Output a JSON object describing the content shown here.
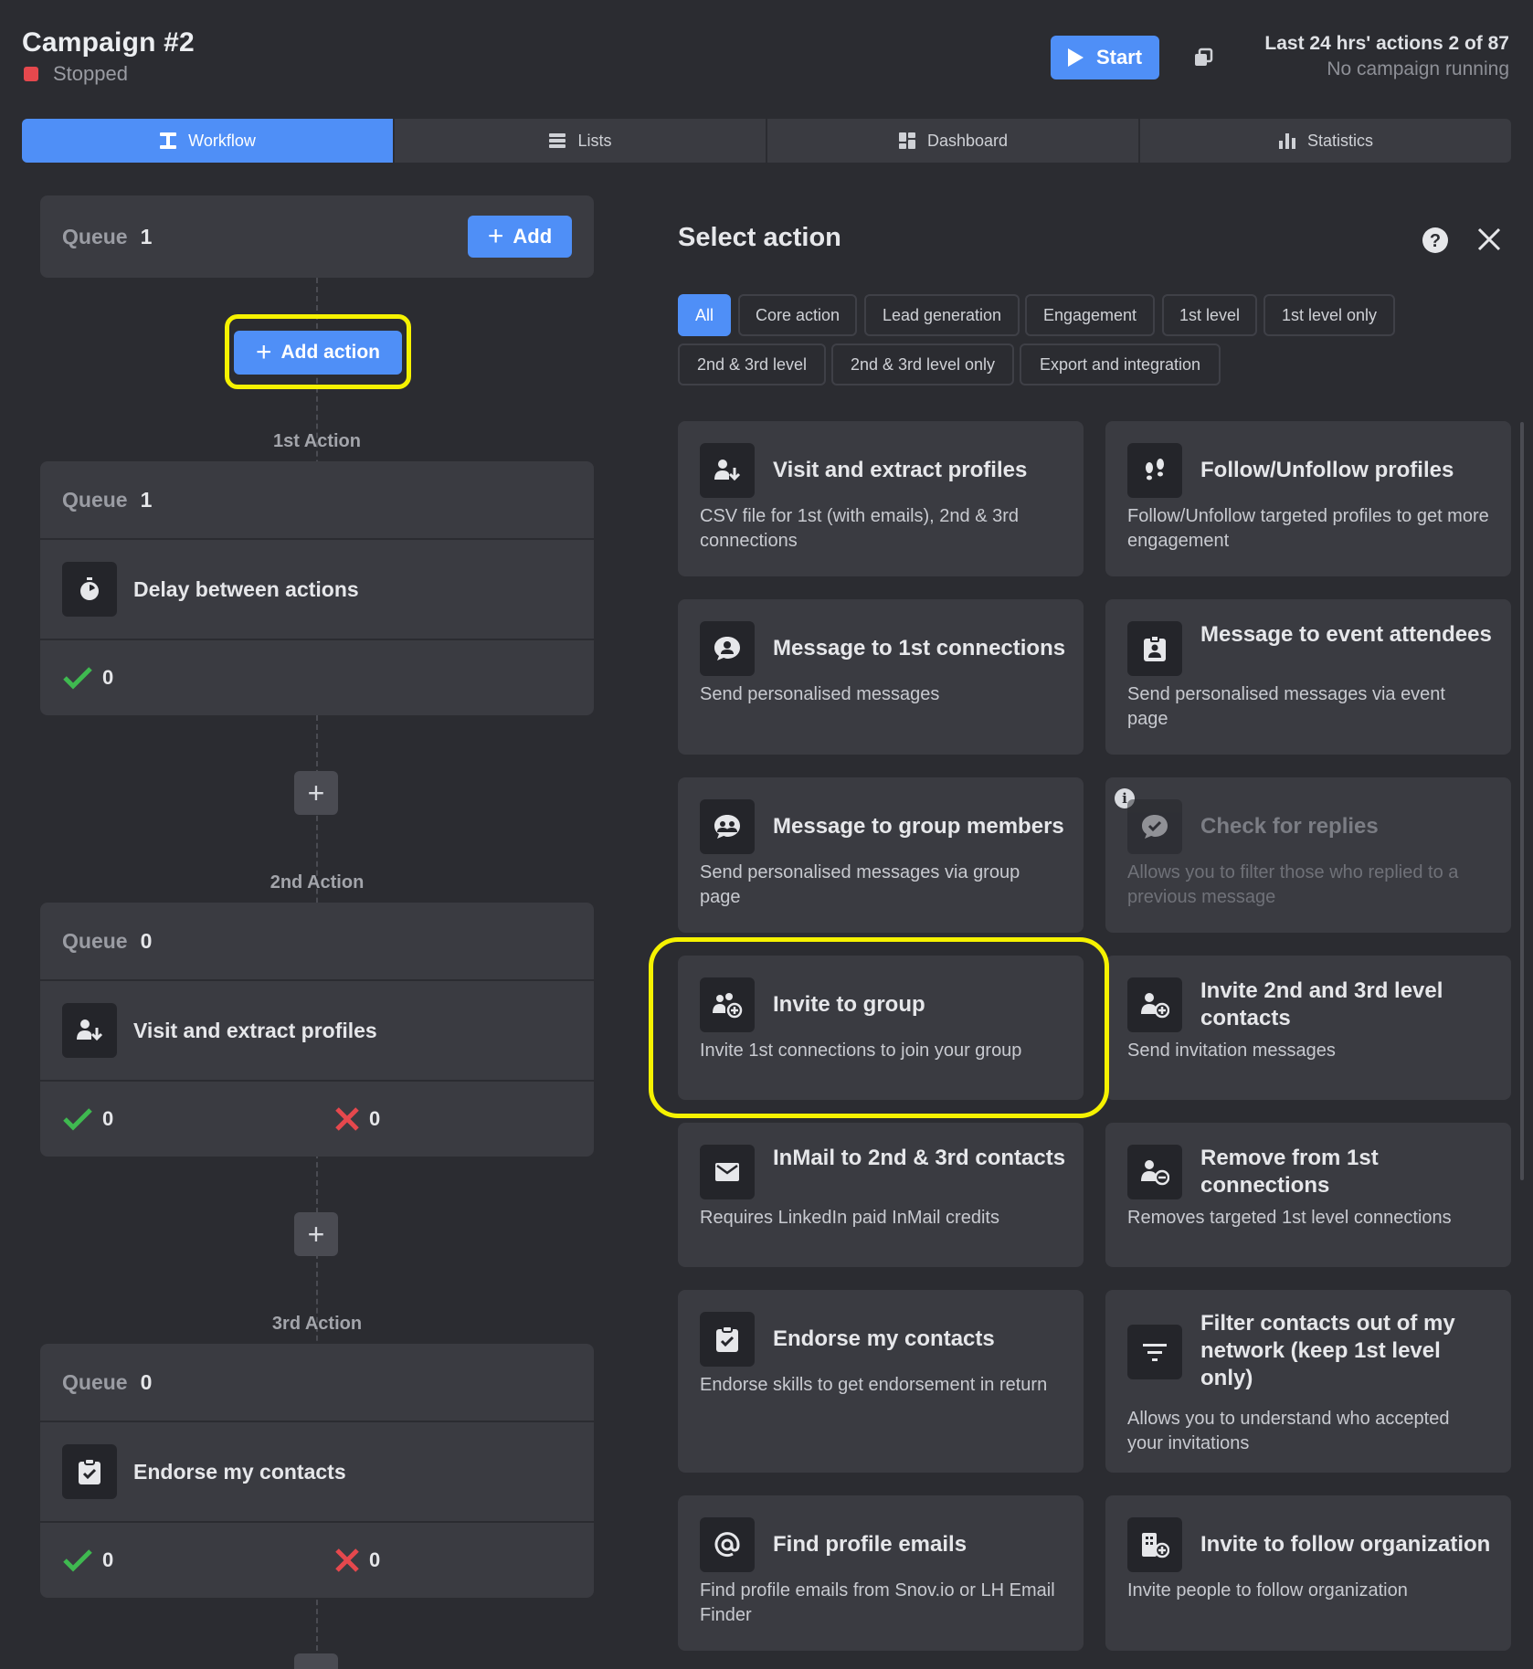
{
  "header": {
    "campaign_title": "Campaign #2",
    "status": "Stopped",
    "status_color": "#e5484d",
    "start_label": "Start",
    "last24": "Last 24 hrs' actions 2 of 87",
    "running_status": "No campaign running"
  },
  "tabs": [
    {
      "label": "Workflow",
      "icon": "workflow-icon",
      "active": true
    },
    {
      "label": "Lists",
      "icon": "list-icon",
      "active": false
    },
    {
      "label": "Dashboard",
      "icon": "dashboard-icon",
      "active": false
    },
    {
      "label": "Statistics",
      "icon": "bar-chart-icon",
      "active": false
    }
  ],
  "workflow": {
    "top_queue": {
      "label": "Queue",
      "count": "1",
      "add_label": "Add"
    },
    "add_action_label": "Add action",
    "actions": [
      {
        "heading": "1st Action",
        "queue_label": "Queue",
        "queue_count": "1",
        "name": "Delay between actions",
        "icon": "stopwatch-icon",
        "success": "0"
      },
      {
        "heading": "2nd Action",
        "queue_label": "Queue",
        "queue_count": "0",
        "name": "Visit and extract profiles",
        "icon": "person-download-icon",
        "success": "0",
        "failed": "0"
      },
      {
        "heading": "3rd Action",
        "queue_label": "Queue",
        "queue_count": "0",
        "name": "Endorse my contacts",
        "icon": "clipboard-check-icon",
        "success": "0",
        "failed": "0"
      }
    ]
  },
  "panel": {
    "title": "Select action",
    "filters": [
      "All",
      "Core action",
      "Lead generation",
      "Engagement",
      "1st level",
      "1st level only",
      "2nd & 3rd level",
      "2nd & 3rd level only",
      "Export and integration"
    ],
    "active_filter": "All",
    "cards": [
      {
        "title": "Visit and extract profiles",
        "desc": "CSV file for 1st (with emails), 2nd & 3rd connections",
        "icon": "person-download-icon"
      },
      {
        "title": "Follow/Unfollow profiles",
        "desc": "Follow/Unfollow targeted profiles to get more engagement",
        "icon": "footprints-icon"
      },
      {
        "title": "Message to 1st connections",
        "desc": "Send personalised messages",
        "icon": "chat-person-icon"
      },
      {
        "title": "Message to event attendees",
        "desc": "Send personalised messages via event page",
        "icon": "event-badge-icon"
      },
      {
        "title": "Message to group members",
        "desc": "Send personalised messages via group page",
        "icon": "chat-group-icon"
      },
      {
        "title": "Check for replies",
        "desc": "Allows you to filter those who replied to a previous message",
        "icon": "chat-check-icon",
        "disabled": true
      },
      {
        "title": "Invite to group",
        "desc": "Invite 1st connections to join your group",
        "icon": "group-add-icon"
      },
      {
        "title": "Invite 2nd and 3rd level contacts",
        "desc": "Send invitation messages",
        "icon": "person-add-icon"
      },
      {
        "title": "InMail to 2nd & 3rd contacts",
        "desc": "Requires LinkedIn paid InMail credits",
        "icon": "envelope-icon"
      },
      {
        "title": "Remove from 1st connections",
        "desc": "Removes targeted 1st level connections",
        "icon": "person-remove-icon"
      },
      {
        "title": "Endorse my contacts",
        "desc": "Endorse skills to get endorsement in return",
        "icon": "clipboard-check-icon"
      },
      {
        "title": "Filter contacts out of my network (keep 1st level only)",
        "desc": "Allows you to understand who accepted your invitations",
        "icon": "filter-icon"
      },
      {
        "title": "Find profile emails",
        "desc": "Find profile emails from Snov.io or LH Email Finder",
        "icon": "at-sign-icon"
      },
      {
        "title": "Invite to follow organization",
        "desc": "Invite people to follow organization",
        "icon": "building-add-icon"
      }
    ]
  },
  "colors": {
    "accent": "#4f8ff7",
    "highlight": "#f6f200",
    "success": "#3fb950",
    "error": "#e5484d"
  }
}
